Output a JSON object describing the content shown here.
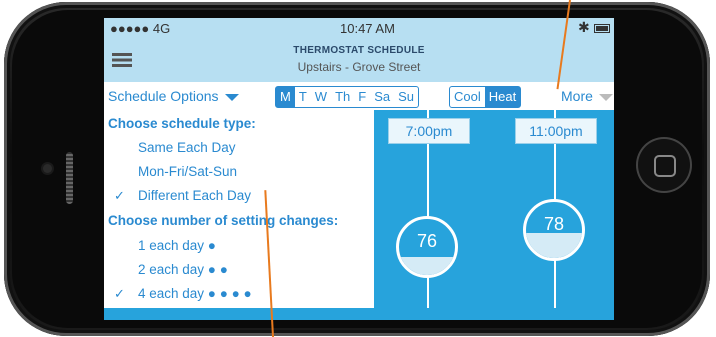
{
  "status": {
    "carrier": "●●●●● 4G",
    "time": "10:47 AM",
    "bluetooth": "bluetooth-icon",
    "battery": "battery-icon"
  },
  "header": {
    "title": "THERMOSTAT SCHEDULE",
    "subtitle": "Upstairs - Grove Street",
    "menu_icon": "hamburger-icon"
  },
  "toolbar": {
    "schedule_options": "Schedule Options",
    "days": [
      {
        "label": "M",
        "active": true
      },
      {
        "label": "T",
        "active": false
      },
      {
        "label": "W",
        "active": false
      },
      {
        "label": "Th",
        "active": false
      },
      {
        "label": "F",
        "active": false
      },
      {
        "label": "Sa",
        "active": false
      },
      {
        "label": "Su",
        "active": false
      }
    ],
    "modes": [
      {
        "label": "Cool",
        "active": false
      },
      {
        "label": "Heat",
        "active": true
      }
    ],
    "more": "More"
  },
  "dropdown": {
    "schedule_type_header": "Choose schedule type:",
    "schedule_types": [
      {
        "label": "Same Each Day",
        "checked": false
      },
      {
        "label": "Mon-Fri/Sat-Sun",
        "checked": false
      },
      {
        "label": "Different Each Day",
        "checked": true
      }
    ],
    "changes_header": "Choose number of setting changes:",
    "changes": [
      {
        "label": "1 each day ●",
        "checked": false
      },
      {
        "label": "2 each day ● ●",
        "checked": false
      },
      {
        "label": "4 each day ● ● ● ●",
        "checked": true
      }
    ],
    "check_mark": "✓"
  },
  "schedule": {
    "slots": [
      {
        "time": "7:00pm",
        "temp": "76",
        "level": 0.33
      },
      {
        "time": "11:00pm",
        "temp": "78",
        "level": 0.45
      }
    ]
  },
  "colors": {
    "accent": "#2a8ad0",
    "panel_blue": "#27a3dc",
    "header_bg": "#b7dff2",
    "annotation": "#e87a1e"
  }
}
